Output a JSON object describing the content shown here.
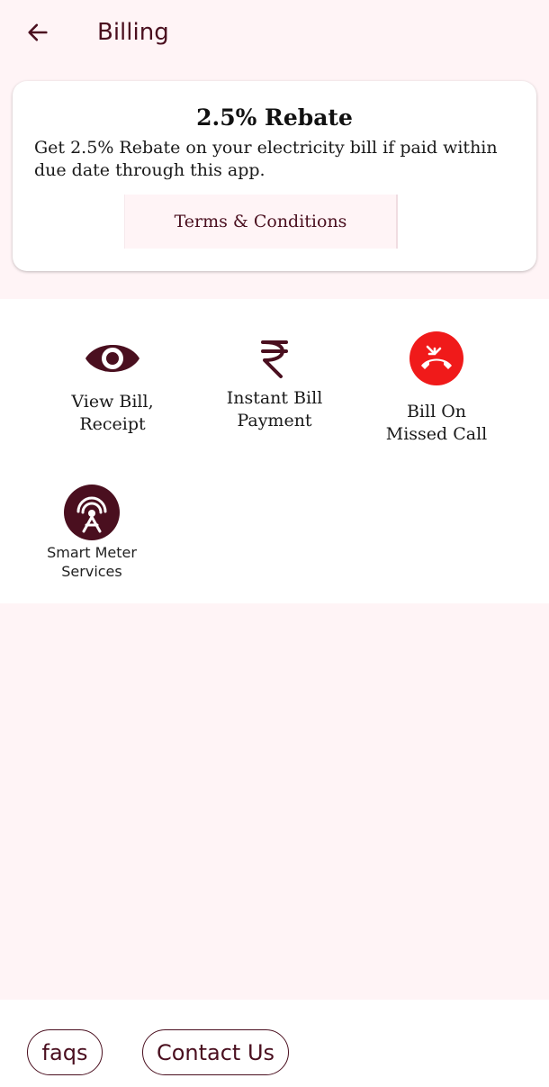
{
  "header": {
    "title": "Billing"
  },
  "rebate": {
    "title": "2.5% Rebate",
    "description": "Get 2.5% Rebate on your electricity bill if paid within due date through this app.",
    "terms_label": "Terms & Conditions"
  },
  "services": [
    {
      "line1": "View Bill,",
      "line2": "Receipt",
      "icon": "eye-icon"
    },
    {
      "line1": "Instant Bill",
      "line2": "Payment",
      "icon": "rupee-icon"
    },
    {
      "line1": "Bill On",
      "line2": "Missed Call",
      "icon": "missed-call-icon"
    },
    {
      "line1": "Smart Meter",
      "line2": "Services",
      "icon": "smart-meter-icon"
    }
  ],
  "footer": {
    "faqs_label": "faqs",
    "contact_label": "Contact Us"
  },
  "colors": {
    "primary": "#4a0f1f",
    "background": "#fff4f6",
    "missed_call_red": "#f01a1a"
  }
}
